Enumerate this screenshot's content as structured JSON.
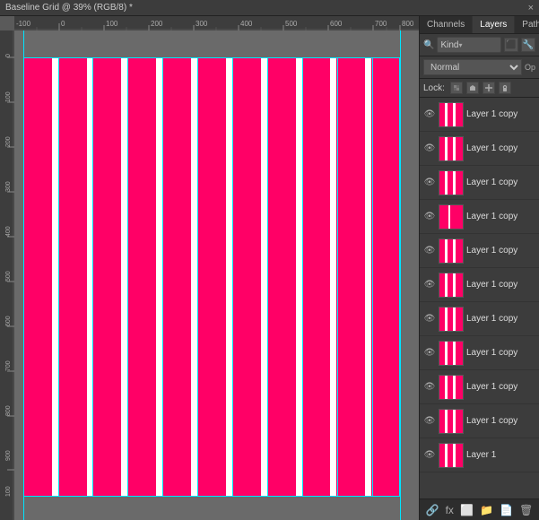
{
  "titleBar": {
    "title": "Baseline Grid @ 39% (RGB/8) *",
    "closeLabel": "×"
  },
  "ruler": {
    "marks": [
      "-100",
      "0",
      "100",
      "200",
      "300",
      "400",
      "500",
      "600",
      "700",
      "800",
      "900",
      "100"
    ]
  },
  "panels": {
    "tabs": [
      {
        "label": "Channels",
        "active": false
      },
      {
        "label": "Layers",
        "active": true
      },
      {
        "label": "Paths",
        "active": false
      }
    ],
    "searchPlaceholder": "Kind",
    "blendMode": "Normal",
    "opacityLabel": "Op",
    "lockLabel": "Lock:",
    "layers": [
      {
        "name": "Layer 1 copy",
        "visible": true,
        "selected": false
      },
      {
        "name": "Layer 1 copy",
        "visible": true,
        "selected": false
      },
      {
        "name": "Layer 1 copy",
        "visible": true,
        "selected": false
      },
      {
        "name": "Layer 1 copy",
        "visible": true,
        "selected": false
      },
      {
        "name": "Layer 1 copy",
        "visible": true,
        "selected": false
      },
      {
        "name": "Layer 1 copy",
        "visible": true,
        "selected": false
      },
      {
        "name": "Layer 1 copy",
        "visible": true,
        "selected": false
      },
      {
        "name": "Layer 1 copy",
        "visible": true,
        "selected": false
      },
      {
        "name": "Layer 1 copy",
        "visible": true,
        "selected": false
      },
      {
        "name": "Layer 1 copy",
        "visible": true,
        "selected": false
      },
      {
        "name": "Layer 1",
        "visible": true,
        "selected": false
      }
    ]
  },
  "colors": {
    "pink": "#ff0066",
    "cyan": "#00e5ff",
    "bg": "#6a6a6a",
    "panelBg": "#3c3c3c"
  }
}
